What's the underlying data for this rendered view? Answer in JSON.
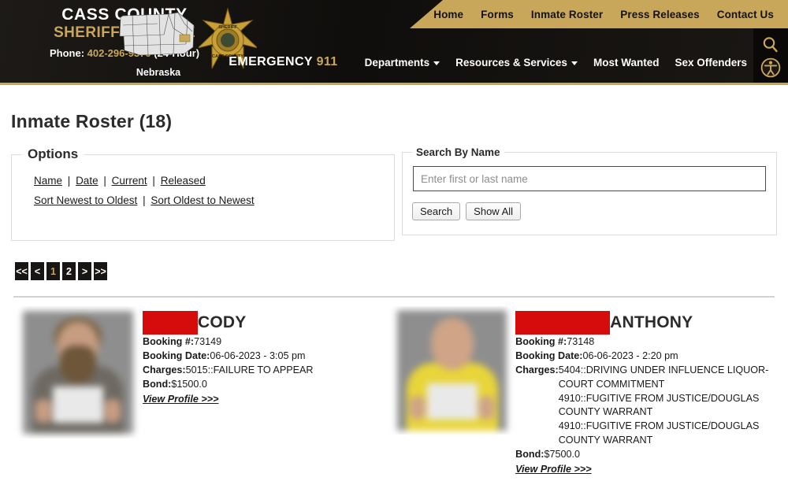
{
  "header": {
    "org_line1": "CASS COUNTY",
    "org_line2": "SHERIFF'S OFFICE",
    "phone_label": "Phone:",
    "phone_number": "402-296-9370",
    "phone_hours": "(24-Hour)",
    "map_label": "Nebraska",
    "badge_text_top": "SHERIFF",
    "badge_text_bottom": "CASS COUNTY",
    "emergency_label": "EMERGENCY",
    "emergency_number": "911",
    "top_links": [
      {
        "label": "Home"
      },
      {
        "label": "Forms"
      },
      {
        "label": "Inmate Roster"
      },
      {
        "label": "Press Releases"
      },
      {
        "label": "Contact Us"
      }
    ],
    "nav_items": [
      {
        "label": "Departments",
        "has_caret": true
      },
      {
        "label": "Resources & Services",
        "has_caret": true
      },
      {
        "label": "Most Wanted",
        "has_caret": false
      },
      {
        "label": "Sex Offenders",
        "has_caret": false
      }
    ],
    "colors": {
      "gold": "#c9a75a",
      "dark": "#151210"
    }
  },
  "page": {
    "title": "Inmate Roster (18)"
  },
  "options": {
    "legend": "Options",
    "filter_links": [
      "Name",
      "Date",
      "Current",
      "Released"
    ],
    "sort_links": [
      "Sort Newest to Oldest",
      "Sort Oldest to Newest"
    ],
    "separator": "|"
  },
  "search": {
    "legend": "Search By Name",
    "placeholder": "Enter first or last name",
    "value": "",
    "search_button": "Search",
    "show_all_button": "Show All"
  },
  "pagination": {
    "first": "<<",
    "prev": "<",
    "pages": [
      "1",
      "2"
    ],
    "active_page": "1",
    "next": ">",
    "last": ">>"
  },
  "inmates": [
    {
      "name": "CODY",
      "name_redacted": true,
      "booking_label": "Booking #:",
      "booking_number": "73149",
      "booking_date_label": "Booking Date:",
      "booking_date": "06-06-2023 - 3:05 pm",
      "charges_label": "Charges:",
      "charges": [
        "5015::FAILURE TO APPEAR"
      ],
      "bond_label": "Bond:",
      "bond": "$1500.0",
      "view_profile": "View Profile >>>",
      "mugshot_shirt_color": "#6e6a63"
    },
    {
      "name": "ANTHONY",
      "name_redacted": true,
      "booking_label": "Booking #:",
      "booking_number": "73148",
      "booking_date_label": "Booking Date:",
      "booking_date": "06-06-2023 - 2:20 pm",
      "charges_label": "Charges:",
      "charges": [
        "5404::DRIVING UNDER INFLUENCE LIQUOR-COURT COMMITMENT",
        "4910::FUGITIVE FROM JUSTICE/DOUGLAS COUNTY WARRANT",
        "4910::FUGITIVE FROM JUSTICE/DOUGLAS COUNTY WARRANT"
      ],
      "bond_label": "Bond:",
      "bond": "$7500.0",
      "view_profile": "View Profile >>>",
      "mugshot_shirt_color": "#e8d53a"
    }
  ],
  "icons": {
    "search": "search-icon",
    "accessibility": "accessibility-icon"
  }
}
